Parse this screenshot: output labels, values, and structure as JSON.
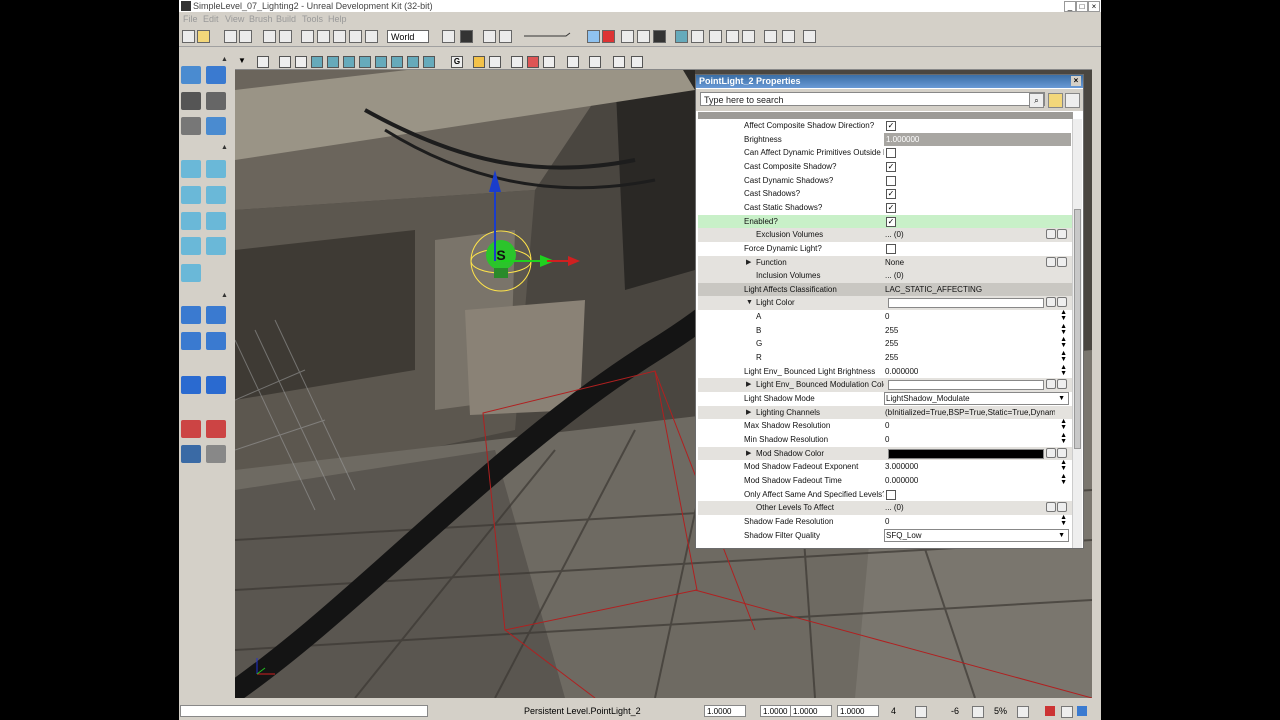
{
  "window": {
    "title": "SimpleLevel_07_Lighting2 - Unreal Development Kit (32-bit)",
    "minimize": "_",
    "maximize": "□",
    "close": "×"
  },
  "menu": [
    "File",
    "Edit",
    "View",
    "Brush",
    "Build",
    "Tools",
    "Help"
  ],
  "toolbar": {
    "coordinate_system": "World"
  },
  "properties": {
    "title": "PointLight_2 Properties",
    "search_placeholder": "Type here to search",
    "rows": [
      {
        "label": "Affect Composite Shadow Direction?",
        "type": "check",
        "checked": true,
        "indent": 0
      },
      {
        "label": "Brightness",
        "type": "field",
        "value": "1.000000",
        "indent": 0
      },
      {
        "label": "Can Affect Dynamic Primitives Outside D",
        "type": "check",
        "checked": false,
        "indent": 0
      },
      {
        "label": "Cast Composite Shadow?",
        "type": "check",
        "checked": true,
        "indent": 0
      },
      {
        "label": "Cast Dynamic Shadows?",
        "type": "check",
        "checked": false,
        "indent": 0
      },
      {
        "label": "Cast Shadows?",
        "type": "check",
        "checked": true,
        "indent": 0
      },
      {
        "label": "Cast Static Shadows?",
        "type": "check",
        "checked": true,
        "indent": 0
      },
      {
        "label": "Enabled?",
        "type": "check",
        "checked": true,
        "indent": 0,
        "highlight": true
      },
      {
        "label": "Exclusion Volumes",
        "type": "value",
        "value": "... (0)",
        "indent": 1,
        "controls": 2
      },
      {
        "label": "Force Dynamic Light?",
        "type": "check",
        "checked": false,
        "indent": 0
      },
      {
        "label": "Function",
        "type": "value",
        "value": "None",
        "indent": 1,
        "expander": "right",
        "controls": 2
      },
      {
        "label": "Inclusion Volumes",
        "type": "value",
        "value": "... (0)",
        "indent": 1
      },
      {
        "label": "Light Affects Classification",
        "type": "value",
        "value": "LAC_STATIC_AFFECTING",
        "indent": 0,
        "dark": true
      },
      {
        "label": "Light Color",
        "type": "color",
        "indent": 1,
        "expander": "down",
        "swatch": "#ffffff",
        "controls": 2
      },
      {
        "label": "A",
        "type": "value",
        "value": "0",
        "indent": 2,
        "spin": true
      },
      {
        "label": "B",
        "type": "value",
        "value": "255",
        "indent": 2,
        "spin": true
      },
      {
        "label": "G",
        "type": "value",
        "value": "255",
        "indent": 2,
        "spin": true
      },
      {
        "label": "R",
        "type": "value",
        "value": "255",
        "indent": 2,
        "spin": true
      },
      {
        "label": "Light Env_ Bounced Light Brightness",
        "type": "value",
        "value": "0.000000",
        "indent": 0,
        "spin": true
      },
      {
        "label": "Light Env_ Bounced Modulation Color",
        "type": "color",
        "indent": 1,
        "expander": "right",
        "swatch": "#ffffff",
        "controls": 2
      },
      {
        "label": "Light Shadow Mode",
        "type": "select",
        "value": "LightShadow_Modulate",
        "indent": 0
      },
      {
        "label": "Lighting Channels",
        "type": "value",
        "value": "(bInitialized=True,BSP=True,Static=True,Dynamic=F",
        "indent": 1,
        "expander": "right"
      },
      {
        "label": "Max Shadow Resolution",
        "type": "value",
        "value": "0",
        "indent": 0,
        "spin": true
      },
      {
        "label": "Min Shadow Resolution",
        "type": "value",
        "value": "0",
        "indent": 0,
        "spin": true
      },
      {
        "label": "Mod Shadow Color",
        "type": "color",
        "indent": 1,
        "expander": "right",
        "swatch": "#000000",
        "controls": 2
      },
      {
        "label": "Mod Shadow Fadeout Exponent",
        "type": "value",
        "value": "3.000000",
        "indent": 0,
        "spin": true
      },
      {
        "label": "Mod Shadow Fadeout Time",
        "type": "value",
        "value": "0.000000",
        "indent": 0,
        "spin": true
      },
      {
        "label": "Only Affect Same And Specified Levels?",
        "type": "check",
        "checked": false,
        "indent": 0
      },
      {
        "label": "Other Levels To Affect",
        "type": "value",
        "value": "... (0)",
        "indent": 1,
        "controls": 2
      },
      {
        "label": "Shadow Fade Resolution",
        "type": "value",
        "value": "0",
        "indent": 0,
        "spin": true
      },
      {
        "label": "Shadow Filter Quality",
        "type": "select",
        "value": "SFQ_Low",
        "indent": 0
      }
    ]
  },
  "status": {
    "level": "Persistent Level.PointLight_2",
    "drag_x": "1.0000",
    "drag_y": "1.0000",
    "drag_z": "1.0000",
    "drag_w": "1.0000",
    "grid": "4",
    "rot": "-6",
    "snap": "5%"
  }
}
